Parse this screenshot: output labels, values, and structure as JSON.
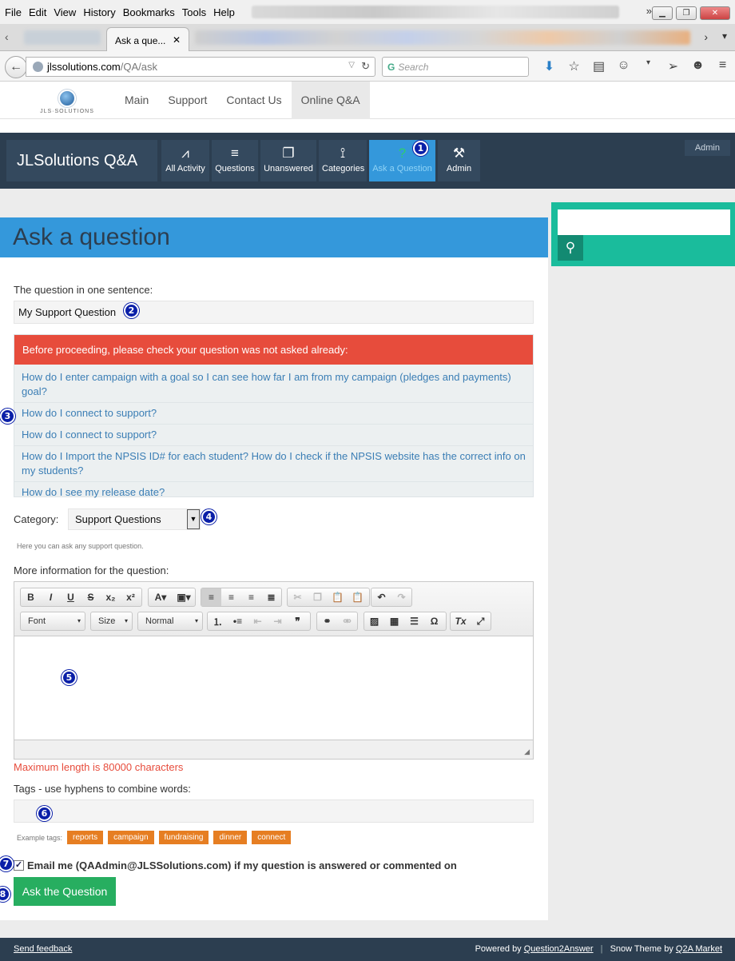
{
  "browser": {
    "menu": [
      "File",
      "Edit",
      "View",
      "History",
      "Bookmarks",
      "Tools",
      "Help"
    ],
    "active_tab_title": "Ask a que...",
    "url_host": "jlssolutions.com",
    "url_path": "/QA/ask",
    "search_placeholder": "Search"
  },
  "site_nav": {
    "logo_text": "JLS·SOLUTIONS",
    "links": [
      "Main",
      "Support",
      "Contact Us",
      "Online Q&A"
    ],
    "active": "Online Q&A"
  },
  "qa_header": {
    "logo": "JLSolutions Q&A",
    "nav": [
      {
        "label": "All Activity",
        "icon": "activity-icon"
      },
      {
        "label": "Questions",
        "icon": "list-icon"
      },
      {
        "label": "Unanswered",
        "icon": "unanswered-icon"
      },
      {
        "label": "Categories",
        "icon": "categories-icon"
      },
      {
        "label": "Ask a Question",
        "icon": "question-icon",
        "active": true
      },
      {
        "label": "Admin",
        "icon": "tools-icon"
      }
    ],
    "user_link": "Admin"
  },
  "page": {
    "title": "Ask a question",
    "question_label": "The question in one sentence:",
    "question_value": "My Support Question",
    "similar_heading": "Before proceeding, please check your question was not asked already:",
    "similar_questions": [
      "How do I enter campaign with a goal so I can see how far I am from my campaign (pledges and payments) goal?",
      "How do I connect to support?",
      "How do I connect to support?",
      "How do I Import the NPSIS ID# for each student? How do I check if the NPSIS website has the correct info on my students?",
      "How do I see my release date?"
    ],
    "category_label": "Category:",
    "category_value": "Support Questions",
    "category_note": "Here you can ask any support question.",
    "more_info_label": "More information for the question:",
    "editor": {
      "font_combo": "Font",
      "size_combo": "Size",
      "format_combo": "Normal",
      "content": ""
    },
    "max_length_note": "Maximum length is 80000 characters",
    "tags_label": "Tags - use hyphens to combine words:",
    "tags_value": "",
    "example_tags_label": "Example tags:",
    "example_tags": [
      "reports",
      "campaign",
      "fundraising",
      "dinner",
      "connect"
    ],
    "notify_label": "Email me (QAAdmin@JLSSolutions.com) if my question is answered or commented on",
    "notify_checked": true,
    "submit_label": "Ask the Question"
  },
  "footer": {
    "feedback": "Send feedback",
    "powered_prefix": "Powered by",
    "powered_link": "Question2Answer",
    "theme_prefix": "Snow Theme by",
    "theme_link": "Q2A Market"
  },
  "markers": [
    "1",
    "2",
    "3",
    "4",
    "5",
    "6",
    "7",
    "8"
  ],
  "colors": {
    "header_dark": "#2c3e50",
    "accent_blue": "#3498db",
    "alert_red": "#e74c3c",
    "teal": "#1abc9c",
    "tag_orange": "#e67e22",
    "submit_green": "#27ae60",
    "marker_blue": "#0a1fa8"
  }
}
